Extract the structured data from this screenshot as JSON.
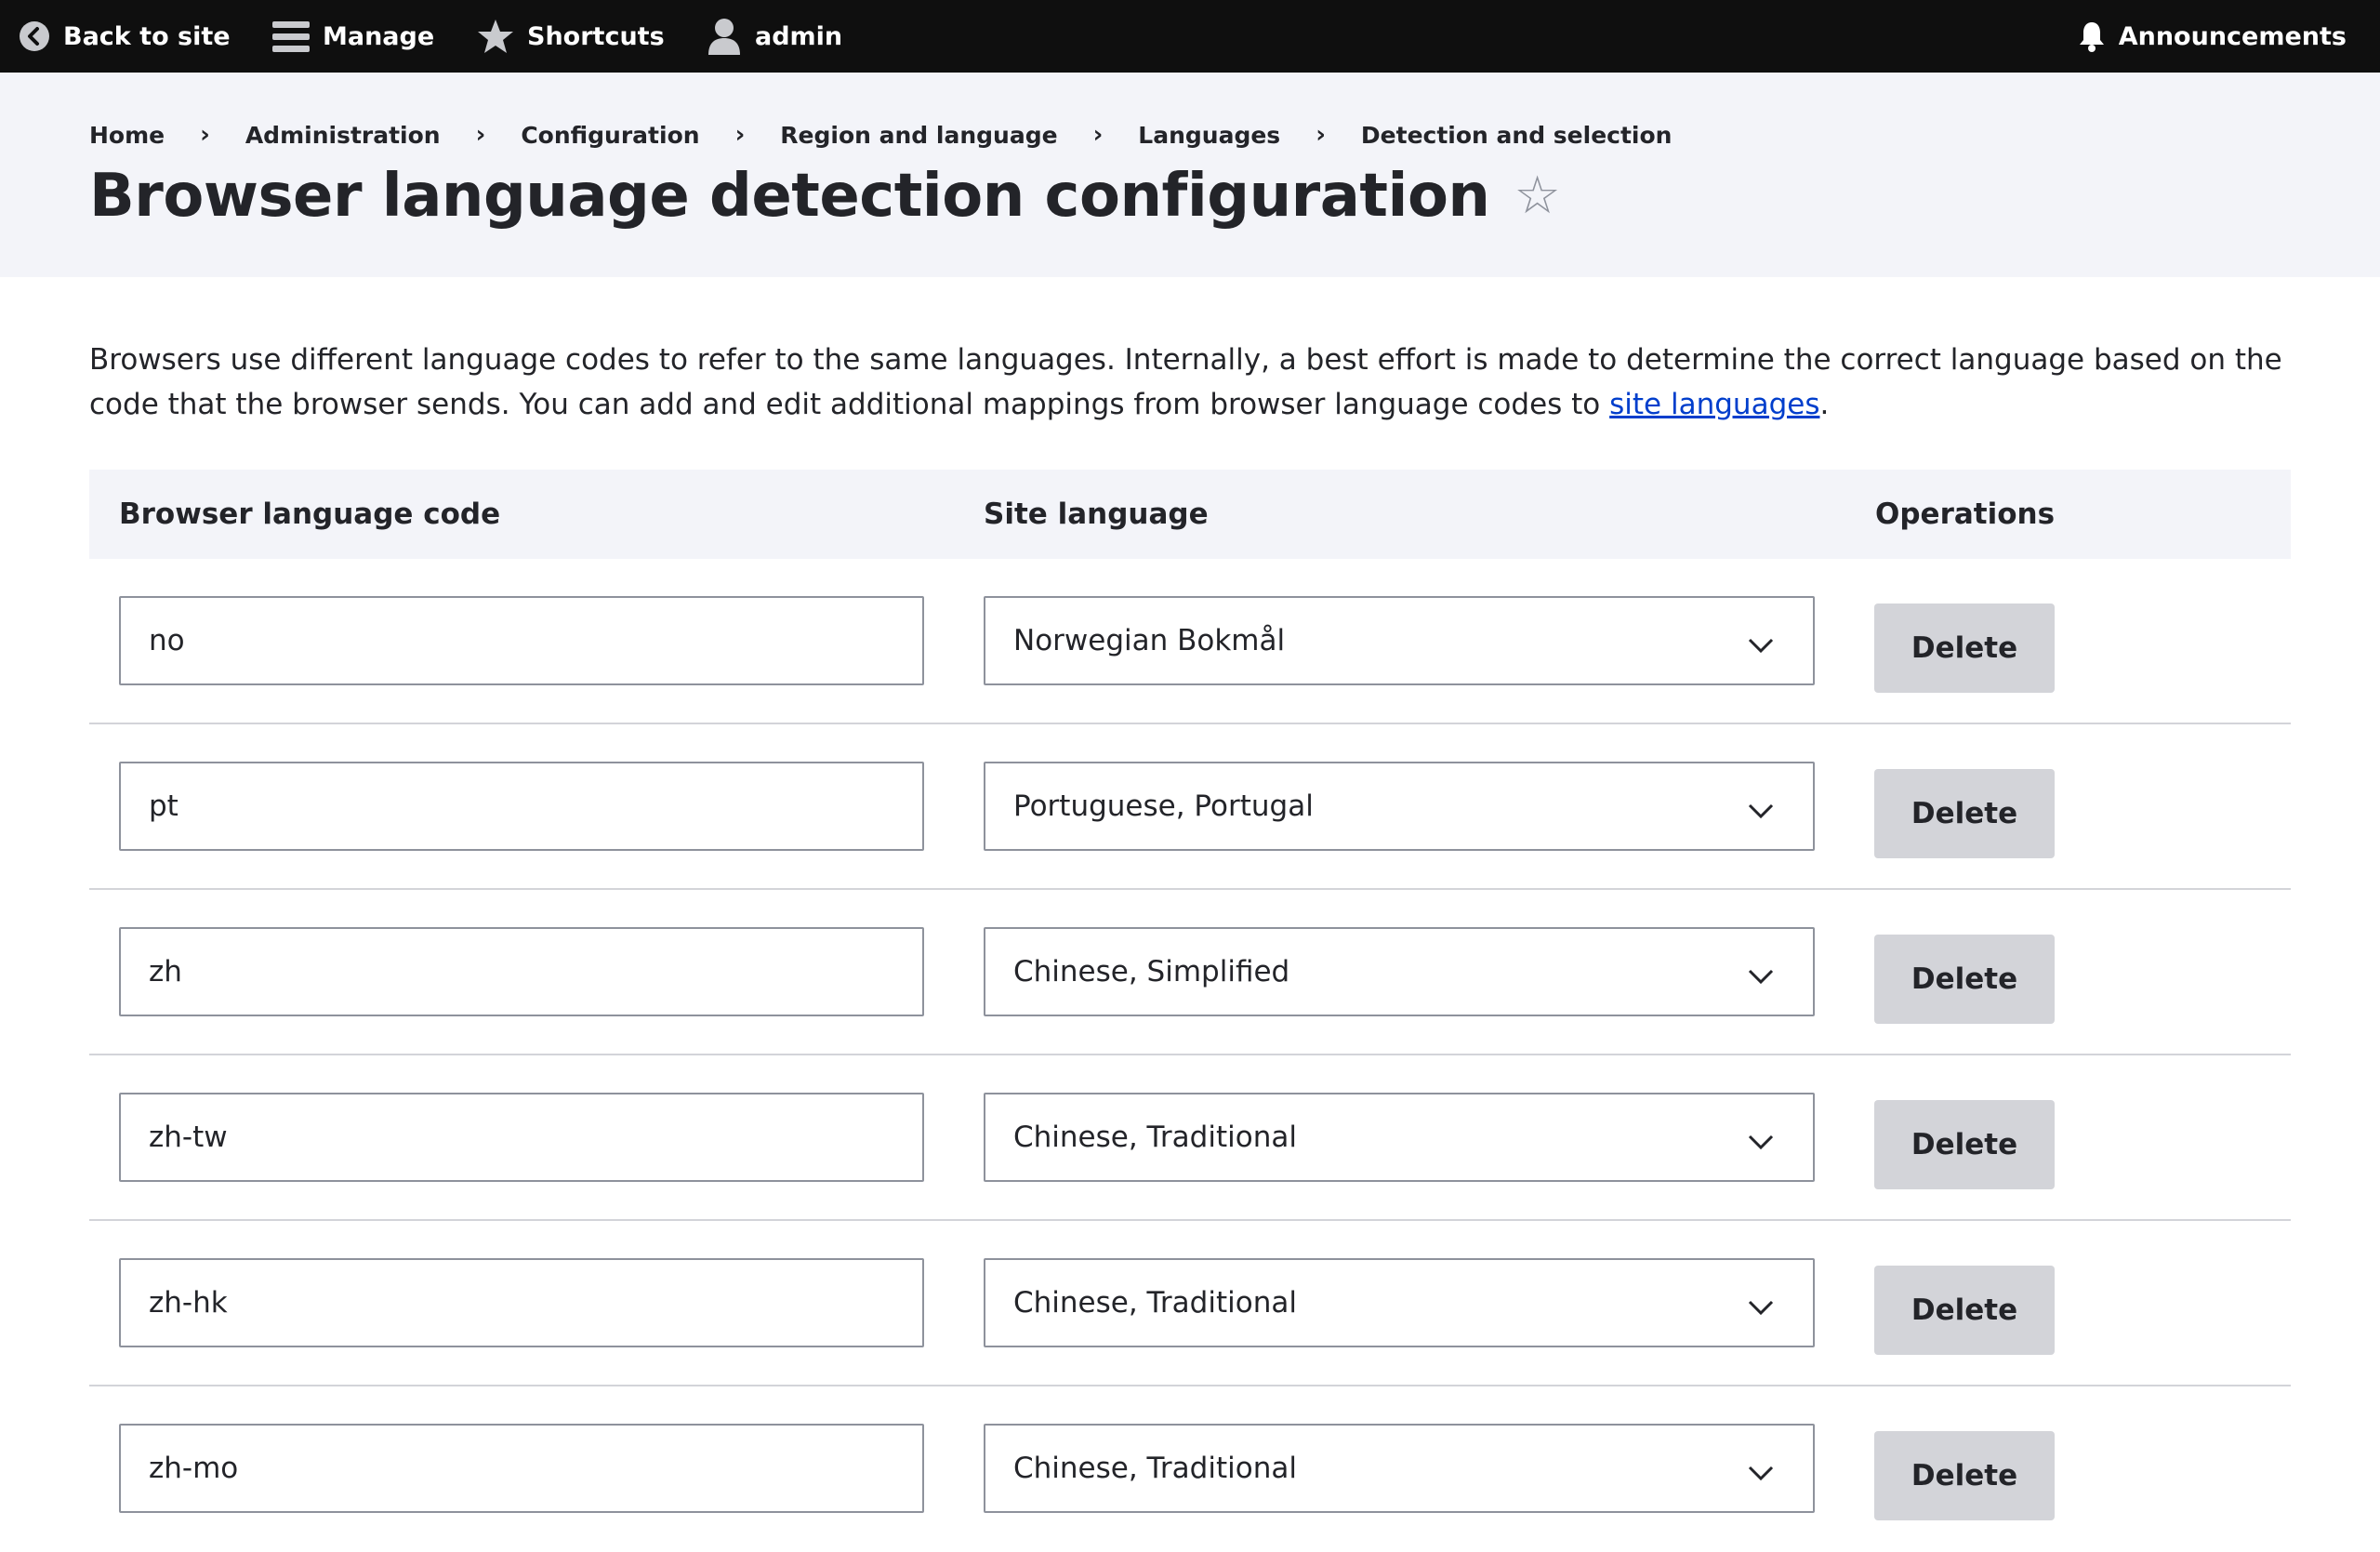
{
  "toolbar": {
    "back_label": "Back to site",
    "manage_label": "Manage",
    "shortcuts_label": "Shortcuts",
    "user_label": "admin",
    "announcements_label": "Announcements"
  },
  "breadcrumb": [
    "Home",
    "Administration",
    "Configuration",
    "Region and language",
    "Languages",
    "Detection and selection"
  ],
  "page": {
    "title": "Browser language detection configuration",
    "description_text": "Browsers use different language codes to refer to the same languages. Internally, a best effort is made to determine the correct language based on the code that the browser sends. You can add and edit additional mappings from browser language codes to ",
    "description_link": "site languages",
    "description_end": "."
  },
  "table": {
    "headers": [
      "Browser language code",
      "Site language",
      "Operations"
    ],
    "rows": [
      {
        "code": "no",
        "language": "Norwegian Bokmål",
        "op": "Delete"
      },
      {
        "code": "pt",
        "language": "Portuguese, Portugal",
        "op": "Delete"
      },
      {
        "code": "zh",
        "language": "Chinese, Simplified",
        "op": "Delete"
      },
      {
        "code": "zh-tw",
        "language": "Chinese, Traditional",
        "op": "Delete"
      },
      {
        "code": "zh-hk",
        "language": "Chinese, Traditional",
        "op": "Delete"
      },
      {
        "code": "zh-mo",
        "language": "Chinese, Traditional",
        "op": "Delete"
      }
    ]
  },
  "colors": {
    "toolbar_bg": "#0f0f0f",
    "header_bg": "#f3f4f9",
    "link": "#003ecc",
    "button_bg": "#d3d4d9"
  },
  "icons": {
    "back": "chevron-left-circle-icon",
    "manage": "hamburger-icon",
    "shortcuts": "star-icon",
    "user": "person-icon",
    "announcements": "bell-icon",
    "favorite": "star-outline-icon",
    "select": "chevron-down-icon"
  }
}
